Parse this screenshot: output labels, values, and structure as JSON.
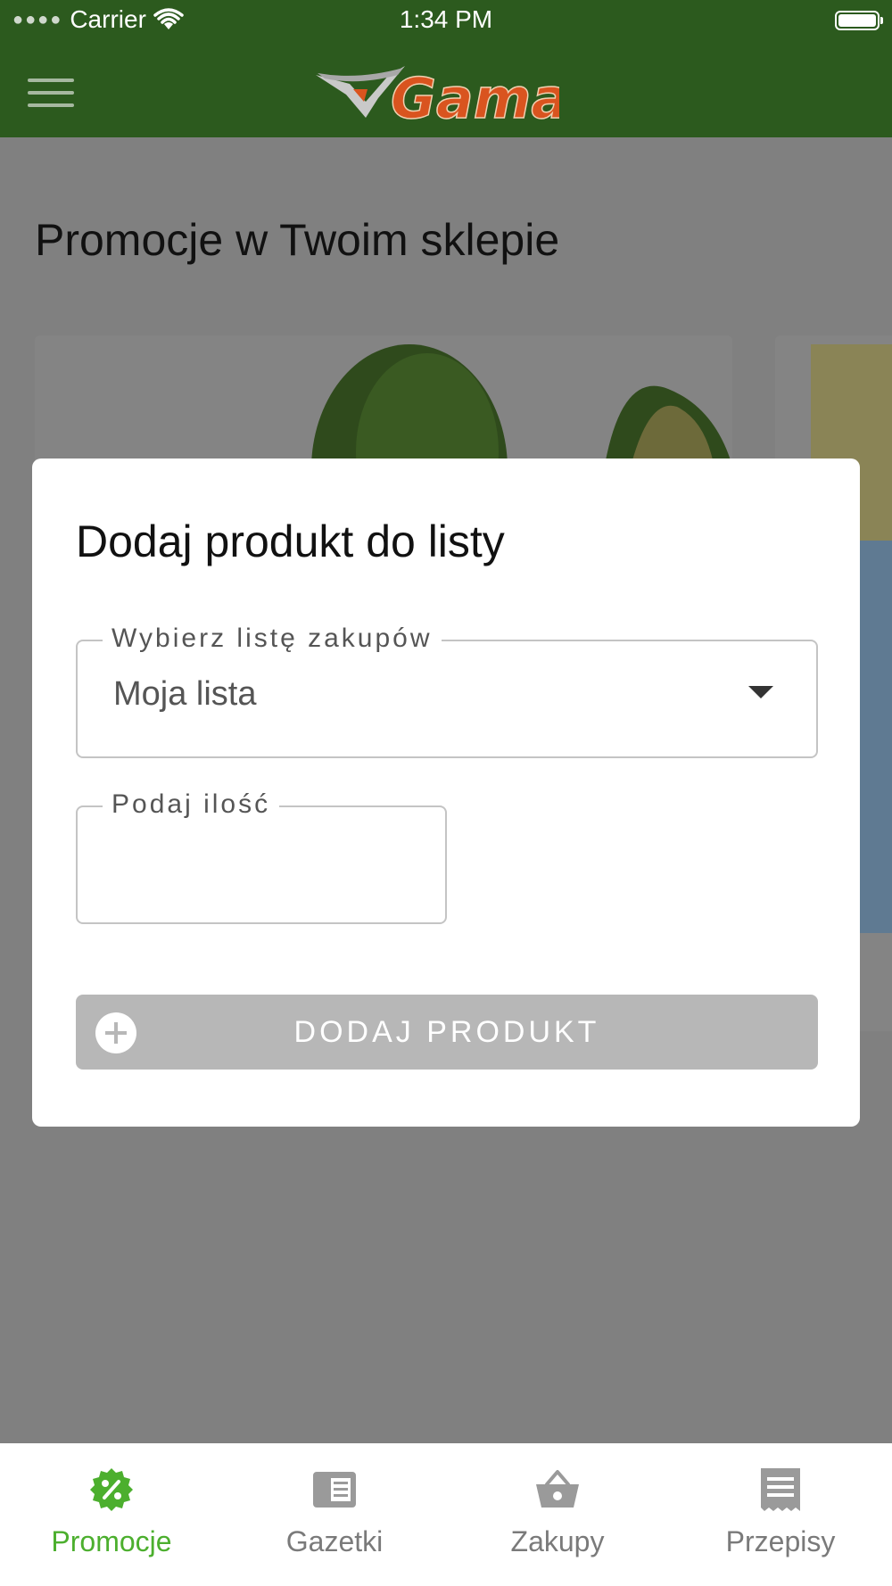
{
  "status_bar": {
    "carrier": "Carrier",
    "time": "1:34 PM"
  },
  "header": {
    "logo_text": "Gama",
    "menu_icon": "hamburger-icon"
  },
  "main": {
    "title": "Promocje w Twoim sklepie"
  },
  "dialog": {
    "title": "Dodaj produkt do listy",
    "list_field": {
      "label": "Wybierz listę zakupów",
      "value": "Moja lista"
    },
    "quantity_field": {
      "label": "Podaj ilość",
      "value": ""
    },
    "add_button": {
      "label": "DODAJ PRODUKT",
      "icon": "plus-circle-icon"
    }
  },
  "tabbar": {
    "active": "Promocje",
    "active_color": "#4caf2e",
    "inactive_color": "#7a7a7a",
    "items": [
      {
        "label": "Promocje",
        "icon": "percent-badge-icon"
      },
      {
        "label": "Gazetki",
        "icon": "newspaper-icon"
      },
      {
        "label": "Zakupy",
        "icon": "basket-icon"
      },
      {
        "label": "Przepisy",
        "icon": "receipt-icon"
      }
    ]
  },
  "colors": {
    "header_green": "#2c5a1e",
    "logo_orange": "#d9541f"
  }
}
